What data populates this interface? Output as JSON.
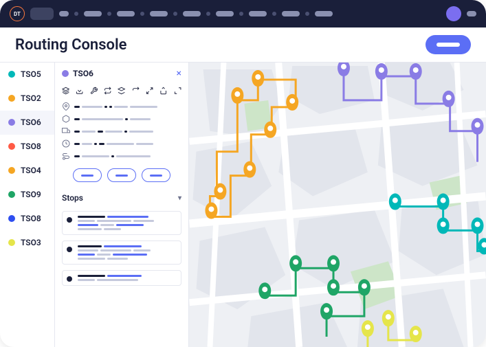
{
  "header": {
    "title": "Routing Console"
  },
  "logo": "DT",
  "panel": {
    "title": "TSO6",
    "section": "Stops"
  },
  "routes": [
    {
      "id": "TSO5",
      "color": "#00b8b8"
    },
    {
      "id": "TSO2",
      "color": "#f5a623"
    },
    {
      "id": "TSO6",
      "color": "#8a7ce5",
      "active": true
    },
    {
      "id": "TSO8",
      "color": "#ff5a45"
    },
    {
      "id": "TSO4",
      "color": "#f5a623"
    },
    {
      "id": "TSO9",
      "color": "#1fa566"
    },
    {
      "id": "TSO8",
      "color": "#2e4ef0"
    },
    {
      "id": "TSO3",
      "color": "#e5e54a"
    }
  ],
  "colors": {
    "orange": "#f5a623",
    "purple": "#8a7ce5",
    "teal": "#00b8b8",
    "green": "#1fa566",
    "yellow": "#e5e54a"
  }
}
